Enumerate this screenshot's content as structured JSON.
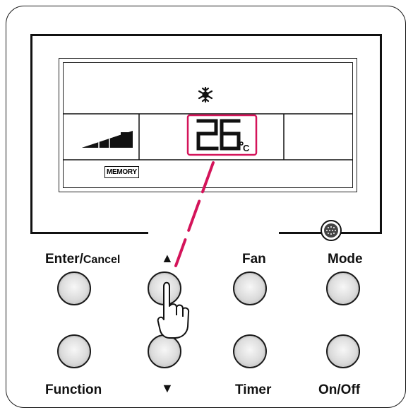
{
  "display": {
    "temperature": "26",
    "unit": "°C",
    "memory_label": "MEMORY",
    "mode_icon": "snowflake-icon",
    "fan_level_icon": "fan-speed-bars-icon",
    "highlight_color": "#d4145a"
  },
  "buttons": {
    "enter_cancel": {
      "label_main": "Enter/",
      "label_small": "Cancel"
    },
    "up": {
      "label": "▲"
    },
    "fan": {
      "label": "Fan"
    },
    "mode": {
      "label": "Mode"
    },
    "function": {
      "label": "Function"
    },
    "down": {
      "label": "▼"
    },
    "timer": {
      "label": "Timer"
    },
    "on_off": {
      "label": "On/Off"
    }
  },
  "sensor_icon": "receiver-grille-icon",
  "pointer_icon": "pressing-hand-icon"
}
